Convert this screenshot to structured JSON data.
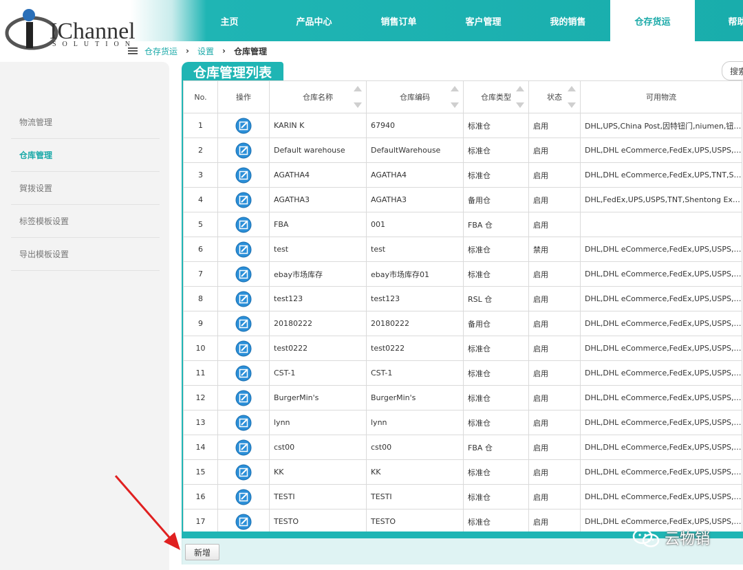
{
  "header": {
    "logo_text": "IChannel",
    "logo_sub": "SOLUTION",
    "nav": [
      {
        "label": "主页"
      },
      {
        "label": "产品中心"
      },
      {
        "label": "销售订单"
      },
      {
        "label": "客户管理"
      },
      {
        "label": "我的销售"
      },
      {
        "label": "仓存货运"
      },
      {
        "label": "帮助"
      }
    ],
    "active_nav_index": 5
  },
  "breadcrumb": {
    "items": [
      "仓存货运",
      "设置",
      "仓库管理"
    ]
  },
  "sidebar": {
    "items": [
      {
        "label": "物流管理"
      },
      {
        "label": "仓库管理"
      },
      {
        "label": "賀拨设置"
      },
      {
        "label": "标签模板设置"
      },
      {
        "label": "导出模板设置"
      }
    ],
    "active_index": 1
  },
  "main": {
    "title": "仓库管理列表",
    "search_label": "搜索"
  },
  "table": {
    "headers": [
      "No.",
      "操作",
      "仓库名称",
      "仓库编码",
      "仓库类型",
      "状态",
      "可用物流"
    ],
    "rows": [
      {
        "no": "1",
        "name": "KARIN K",
        "code": "67940",
        "type": "标准仓",
        "status": "启用",
        "logistics": "DHL,UPS,China Post,因特钮门,niumen,钮门..."
      },
      {
        "no": "2",
        "name": "Default warehouse",
        "code": "DefaultWarehouse",
        "type": "标准仓",
        "status": "启用",
        "logistics": "DHL,DHL eCommerce,FedEx,UPS,USPS,TNT..."
      },
      {
        "no": "3",
        "name": "AGATHA4",
        "code": "AGATHA4",
        "type": "标准仓",
        "status": "启用",
        "logistics": "DHL,DHL eCommerce,FedEx,UPS,TNT,Shent..."
      },
      {
        "no": "4",
        "name": "AGATHA3",
        "code": "AGATHA3",
        "type": "备用仓",
        "status": "启用",
        "logistics": "DHL,FedEx,UPS,USPS,TNT,Shentong Expres..."
      },
      {
        "no": "5",
        "name": "FBA",
        "code": "001",
        "type": "FBA 仓",
        "status": "启用",
        "logistics": ""
      },
      {
        "no": "6",
        "name": "test",
        "code": "test",
        "type": "标准仓",
        "status": "禁用",
        "logistics": "DHL,DHL eCommerce,FedEx,UPS,USPS,TNT..."
      },
      {
        "no": "7",
        "name": "ebay市场库存",
        "code": "ebay市场库存01",
        "type": "标准仓",
        "status": "启用",
        "logistics": "DHL,DHL eCommerce,FedEx,UPS,USPS,TNT..."
      },
      {
        "no": "8",
        "name": "test123",
        "code": "test123",
        "type": "RSL 仓",
        "status": "启用",
        "logistics": "DHL,DHL eCommerce,FedEx,UPS,USPS,TNT..."
      },
      {
        "no": "9",
        "name": "20180222",
        "code": "20180222",
        "type": "备用仓",
        "status": "启用",
        "logistics": "DHL,DHL eCommerce,FedEx,UPS,USPS,TNT..."
      },
      {
        "no": "10",
        "name": "test0222",
        "code": "test0222",
        "type": "标准仓",
        "status": "启用",
        "logistics": "DHL,DHL eCommerce,FedEx,UPS,USPS,TNT..."
      },
      {
        "no": "11",
        "name": "CST-1",
        "code": "CST-1",
        "type": "标准仓",
        "status": "启用",
        "logistics": "DHL,DHL eCommerce,FedEx,UPS,USPS,TNT..."
      },
      {
        "no": "12",
        "name": "BurgerMin's",
        "code": "BurgerMin's",
        "type": "标准仓",
        "status": "启用",
        "logistics": "DHL,DHL eCommerce,FedEx,UPS,USPS,TNT..."
      },
      {
        "no": "13",
        "name": "lynn",
        "code": "lynn",
        "type": "标准仓",
        "status": "启用",
        "logistics": "DHL,DHL eCommerce,FedEx,UPS,USPS,TNT..."
      },
      {
        "no": "14",
        "name": "cst00",
        "code": "cst00",
        "type": "FBA 仓",
        "status": "启用",
        "logistics": "DHL,DHL eCommerce,FedEx,UPS,USPS,TNT..."
      },
      {
        "no": "15",
        "name": "KK",
        "code": "KK",
        "type": "标准仓",
        "status": "启用",
        "logistics": "DHL,DHL eCommerce,FedEx,UPS,USPS,TNT..."
      },
      {
        "no": "16",
        "name": "TESTI",
        "code": "TESTI",
        "type": "标准仓",
        "status": "启用",
        "logistics": "DHL,DHL eCommerce,FedEx,UPS,USPS,TNT..."
      },
      {
        "no": "17",
        "name": "TESTO",
        "code": "TESTO",
        "type": "标准仓",
        "status": "启用",
        "logistics": "DHL,DHL eCommerce,FedEx,UPS,USPS,TNT..."
      }
    ]
  },
  "footer": {
    "add_label": "新增"
  },
  "watermark": {
    "text": "云物销"
  },
  "colors": {
    "accent": "#1fb5b4",
    "arrow": "#e02020"
  }
}
